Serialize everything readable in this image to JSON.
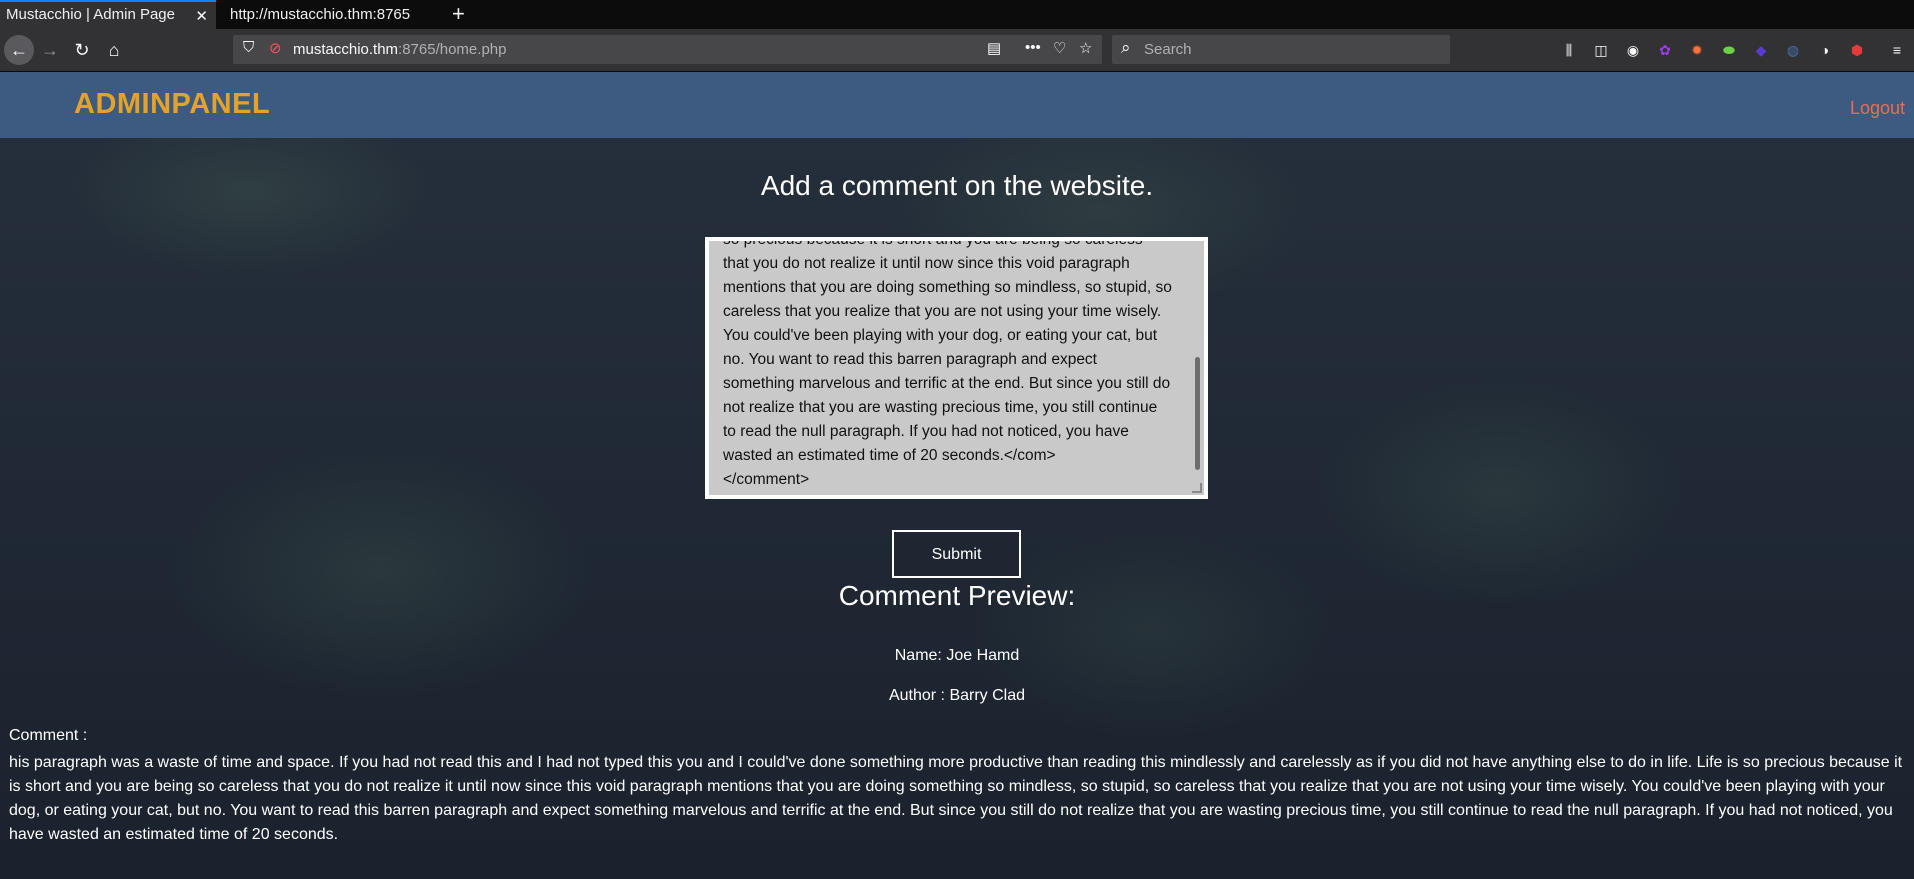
{
  "browser": {
    "tabs": [
      {
        "title": "Mustacchio | Admin Page",
        "active": true
      },
      {
        "title": "http://mustacchio.thm:8765",
        "active": false
      }
    ],
    "url_host": "mustacchio.thm",
    "url_path": ":8765/home.php",
    "search_placeholder": "Search"
  },
  "header": {
    "brand": "ADMINPANEL",
    "logout": "Logout"
  },
  "main": {
    "heading": "Add a comment on the website.",
    "textarea_value": "so precious because it is short and you are being so careless\nthat you do not realize it until now since this void paragraph\nmentions that you are doing something so mindless, so stupid, so\ncareless that you realize that you are not using your time wisely.\nYou could've been playing with your dog, or eating your cat, but\nno. You want to read this barren paragraph and expect\nsomething marvelous and terrific at the end. But since you still do\nnot realize that you are wasting precious time, you still continue\nto read the null paragraph. If you had not noticed, you have\nwasted an estimated time of 20 seconds.</com>\n</comment>",
    "submit_label": "Submit",
    "preview_heading": "Comment Preview:",
    "name_line": "Name: Joe Hamd",
    "author_line": "Author : Barry Clad",
    "comment_label": "Comment :",
    "comment_body": "his paragraph was a waste of time and space. If you had not read this and I had not typed this you and I could've done something more productive than reading this mindlessly and carelessly as if you did not have anything else to do in life. Life is so precious because it is short and you are being so careless that you do not realize it until now since this void paragraph mentions that you are doing something so mindless, so stupid, so careless that you realize that you are not using your time wisely. You could've been playing with your dog, or eating your cat, but no. You want to read this barren paragraph and expect something marvelous and terrific at the end. But since you still do not realize that you are wasting precious time, you still continue to read the null paragraph. If you had not noticed, you have wasted an estimated time of 20 seconds."
  },
  "colors": {
    "header_bg": "#3d5a80",
    "brand": "#e3a32a",
    "logout": "#ee6c4d"
  }
}
